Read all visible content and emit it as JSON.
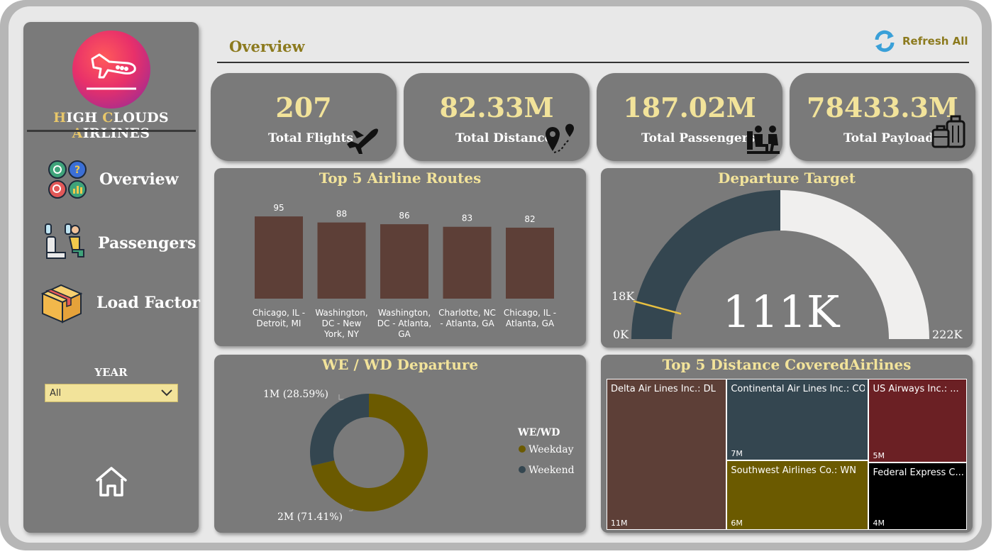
{
  "brand": {
    "name_parts": [
      {
        "cap": "H",
        "rest": "IGH "
      },
      {
        "cap": "C",
        "rest": "LOUDS "
      },
      {
        "cap": "A",
        "rest": "IRLINES"
      }
    ]
  },
  "nav": {
    "items": [
      {
        "label": "Overview",
        "icon": "analytics-icon"
      },
      {
        "label": "Passengers",
        "icon": "seated-passenger-icon"
      },
      {
        "label": "Load Factor",
        "icon": "cargo-box-icon"
      }
    ],
    "home_icon": "home-icon"
  },
  "filter": {
    "label": "YEAR",
    "value": "All"
  },
  "header": {
    "title": "Overview",
    "refresh_label": "Refresh All"
  },
  "kpis": [
    {
      "value": "207",
      "label": "Total Flights",
      "icon": "airplane-icon"
    },
    {
      "value": "82.33M",
      "label": "Total Distance",
      "icon": "map-pin-route-icon"
    },
    {
      "value": "187.02M",
      "label": "Total Passengers",
      "icon": "seated-passengers-icon"
    },
    {
      "value": "78433.3M",
      "label": "Total Payload",
      "icon": "luggage-icon"
    }
  ],
  "routes_card": {
    "title": "Top 5 Airline Routes"
  },
  "gauge_card": {
    "title": "Departure Target",
    "value_label": "111K",
    "min_label": "0K",
    "max_label": "222K",
    "target_label": "18K"
  },
  "donut_card": {
    "title": "WE / WD Departure",
    "legend_title": "WE/WD",
    "top_label": "1M (28.59%)",
    "bottom_label": "2M (71.41%)"
  },
  "treemap_card": {
    "title": "Top 5 Distance CoveredAirlines"
  },
  "colors": {
    "accent": "#f2e39a",
    "title_gold": "#8c7a1e",
    "bar": "#5d3f37",
    "gauge_fill": "#344650",
    "gauge_rest": "#f0efee",
    "weekday": "#6b5a00",
    "weekend": "#344650"
  },
  "chart_data": [
    {
      "type": "bar",
      "title": "Top 5 Airline Routes",
      "categories": [
        "Chicago, IL - Detroit, MI",
        "Washington, DC - New York, NY",
        "Washington, DC - Atlanta, GA",
        "Charlotte, NC - Atlanta, GA",
        "Chicago, IL - Atlanta, GA"
      ],
      "category_lines": [
        [
          "Chicago, IL -",
          "Detroit, MI"
        ],
        [
          "Washington,",
          "DC - New",
          "York, NY"
        ],
        [
          "Washington,",
          "DC - Atlanta,",
          "GA"
        ],
        [
          "Charlotte, NC",
          "- Atlanta, GA"
        ],
        [
          "Chicago, IL -",
          "Atlanta, GA"
        ]
      ],
      "values": [
        95,
        88,
        86,
        83,
        82
      ],
      "ylim": [
        0,
        100
      ],
      "grid": false
    },
    {
      "type": "gauge",
      "title": "Departure Target",
      "value": 111,
      "min": 0,
      "max": 222,
      "target": 18,
      "unit": "K"
    },
    {
      "type": "pie",
      "title": "WE / WD Departure",
      "legend_title": "WE/WD",
      "series": [
        {
          "name": "Weekday",
          "value": 71.41
        },
        {
          "name": "Weekend",
          "value": 28.59
        }
      ],
      "labels": [
        "2M (71.41%)",
        "1M (28.59%)"
      ],
      "donut": true
    },
    {
      "type": "treemap",
      "title": "Top 5 Distance CoveredAirlines",
      "series": [
        {
          "name": "Delta Air Lines Inc.: DL",
          "value": 11,
          "label": "11M",
          "color": "#5d3f37"
        },
        {
          "name": "Continental Air Lines Inc.: CO",
          "value": 7,
          "label": "7M",
          "color": "#344650"
        },
        {
          "name": "Southwest Airlines Co.: WN",
          "value": 6,
          "label": "6M",
          "color": "#6b5a00"
        },
        {
          "name": "US Airways Inc.: ...",
          "value": 5,
          "label": "5M",
          "color": "#6b2024"
        },
        {
          "name": "Federal Express C...",
          "value": 4,
          "label": "4M",
          "color": "#000000"
        }
      ],
      "unit": "M"
    }
  ]
}
